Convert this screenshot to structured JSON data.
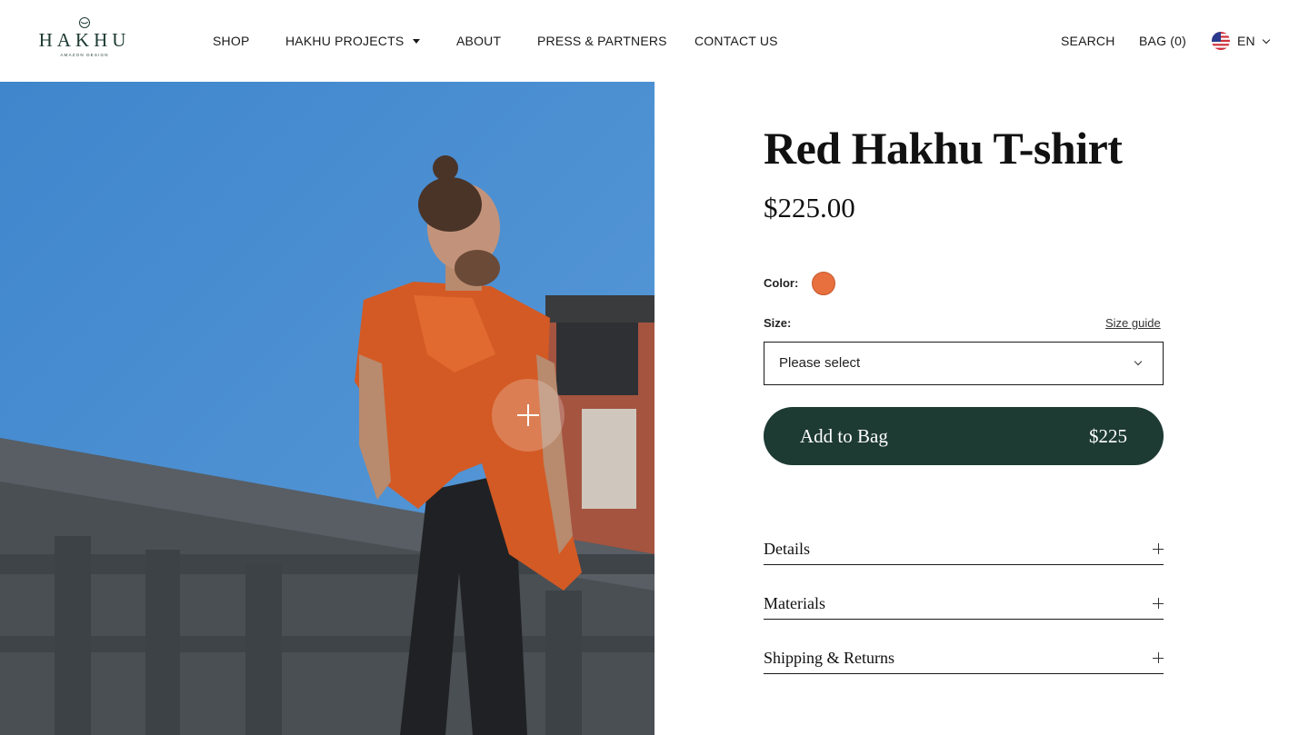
{
  "brand": {
    "name": "HAKHU",
    "tagline": "AMAZON DESIGN"
  },
  "nav": {
    "items": [
      {
        "label": "SHOP"
      },
      {
        "label": "HAKHU PROJECTS"
      },
      {
        "label": "ABOUT"
      },
      {
        "label": "PRESS & PARTNERS"
      },
      {
        "label": "CONTACT US"
      }
    ],
    "search_label": "SEARCH",
    "bag_label": "BAG (0)",
    "language": "EN"
  },
  "product": {
    "title": "Red Hakhu T-shirt",
    "price": "$225.00",
    "color_label": "Color:",
    "color_swatch": "#e8703e",
    "size_label": "Size:",
    "size_guide_label": "Size guide",
    "size_select_value": "Please select",
    "add_button_label": "Add to Bag",
    "add_button_price": "$225",
    "accordion": [
      {
        "label": "Details"
      },
      {
        "label": "Materials"
      },
      {
        "label": "Shipping & Returns"
      }
    ]
  },
  "colors": {
    "brand_green": "#1d3a33",
    "sky_blue": "#4a8ed0",
    "shirt_orange": "#e8703e"
  },
  "icons": [
    "moon-icon",
    "caret-down-icon",
    "us-flag-icon",
    "chevron-down-icon",
    "zoom-plus-icon",
    "plus-icon"
  ]
}
